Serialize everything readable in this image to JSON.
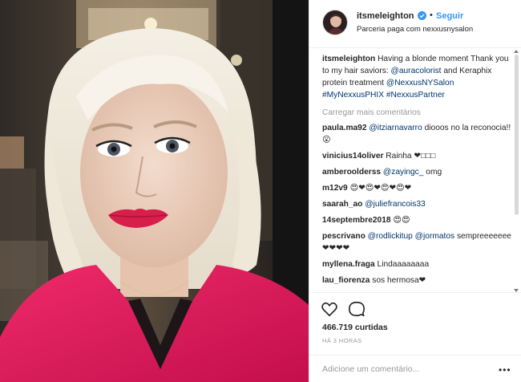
{
  "header": {
    "username": "itsmeleighton",
    "verified_icon": "verified-badge-icon",
    "separator": "•",
    "follow_label": "Seguir",
    "partnership": "Parceria paga com nexxusnysalon"
  },
  "caption": {
    "user": "itsmeleighton",
    "text_1": "Having a blonde moment Thank you to my hair saviors:",
    "mention_1": "@auracolorist",
    "text_2": "and Keraphix protein treatment",
    "mention_2": "@NexxusNYSalon",
    "hashtag_1": "#MyNexxusPHIX",
    "hashtag_2": "#NexxusPartner"
  },
  "load_more": "Carregar mais comentários",
  "comments": [
    {
      "user": "paula.ma92",
      "mention": "@itziarnavarro",
      "text": "diooos no la reconocia!!😮"
    },
    {
      "user": "vinicius14oliver",
      "mention": "",
      "text": "Rainha ❤□□□"
    },
    {
      "user": "amberoolderss",
      "mention": "@zayingc_",
      "text": "omg"
    },
    {
      "user": "m12v9",
      "mention": "",
      "text": "😍❤😍❤😍❤😍❤"
    },
    {
      "user": "saarah_ao",
      "mention": "@juliefrancois33",
      "text": ""
    },
    {
      "user": "14septembre2018",
      "mention": "",
      "text": "😍😍"
    },
    {
      "user": "pescrivano",
      "mention": "@rodlickitup @jormatos",
      "text": "sempreeeeeee ❤❤❤❤"
    },
    {
      "user": "myllena.fraga",
      "mention": "",
      "text": "Lindaaaaaaaa"
    },
    {
      "user": "lau_fiorenza",
      "mention": "",
      "text": "sos hermosa❤"
    }
  ],
  "actions": {
    "like_icon": "heart-icon",
    "comment_icon": "comment-bubble-icon"
  },
  "likes": "466.719 curtidas",
  "timestamp": "HÁ 3 HORAS",
  "add_comment": {
    "placeholder": "Adicione um comentário...",
    "more_label": "•••"
  },
  "colors": {
    "link": "#003569",
    "follow": "#3897f0",
    "muted": "#999999",
    "sweater": "#e2175d",
    "lips": "#d81f4c"
  }
}
